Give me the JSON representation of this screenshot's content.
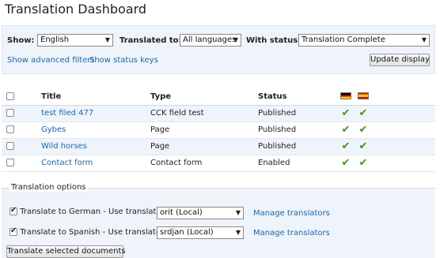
{
  "page_title": "Translation Dashboard",
  "filters": {
    "show_label": "Show:",
    "show_value": "English",
    "translated_to_label": "Translated to:",
    "translated_to_value": "All languages",
    "status_label": "With status:",
    "status_value": "Translation Complete",
    "advanced_filters_link": "Show advanced filters",
    "status_keys_link": "Show status keys",
    "update_button": "Update display"
  },
  "table": {
    "headers": {
      "title": "Title",
      "type": "Type",
      "status": "Status"
    },
    "language_flags": [
      "german-flag-icon",
      "spanish-flag-icon"
    ],
    "rows": [
      {
        "title": "test filed 477",
        "type": "CCK field test",
        "status": "Published"
      },
      {
        "title": "Gybes",
        "type": "Page",
        "status": "Published"
      },
      {
        "title": "Wild horses",
        "type": "Page",
        "status": "Published"
      },
      {
        "title": "Contact form",
        "type": "Contact form",
        "status": "Enabled"
      }
    ]
  },
  "options": {
    "legend": "Translation options",
    "german_label": "Translate to German - Use translator",
    "german_translator": "orit (Local)",
    "spanish_label": "Translate to Spanish - Use translator",
    "spanish_translator": "srdjan (Local)",
    "manage_link": "Manage translators",
    "submit_button": "Translate selected documents"
  }
}
